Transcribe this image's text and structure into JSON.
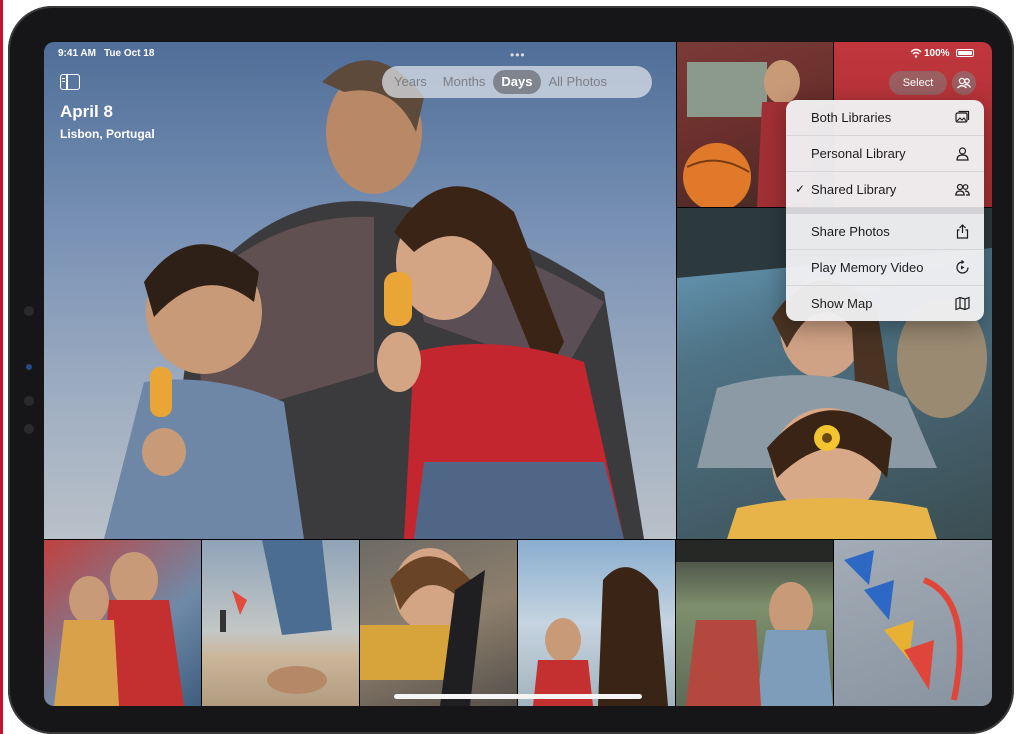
{
  "status_bar": {
    "time": "9:41 AM",
    "date": "Tue Oct 18",
    "battery": "100%",
    "multitask_dots": "•••"
  },
  "header": {
    "title": "April 8",
    "location": "Lisbon, Portugal"
  },
  "view_tabs": [
    "Years",
    "Months",
    "Days",
    "All Photos"
  ],
  "active_tab": "Days",
  "toolbar": {
    "select_label": "Select"
  },
  "menu": {
    "items": [
      {
        "label": "Both Libraries",
        "icon": "photo-library-icon",
        "checked": false
      },
      {
        "label": "Personal Library",
        "icon": "person-icon",
        "checked": false
      },
      {
        "label": "Shared Library",
        "icon": "two-people-icon",
        "checked": true
      },
      {
        "label": "Share Photos",
        "icon": "share-icon",
        "checked": false
      },
      {
        "label": "Play Memory Video",
        "icon": "memory-play-icon",
        "checked": false
      },
      {
        "label": "Show Map",
        "icon": "map-icon",
        "checked": false
      }
    ],
    "check_mark": "✓"
  },
  "colors": {
    "device": "#161618",
    "menu_bg": "#f0f0f2",
    "accent_red": "#c8102e"
  }
}
